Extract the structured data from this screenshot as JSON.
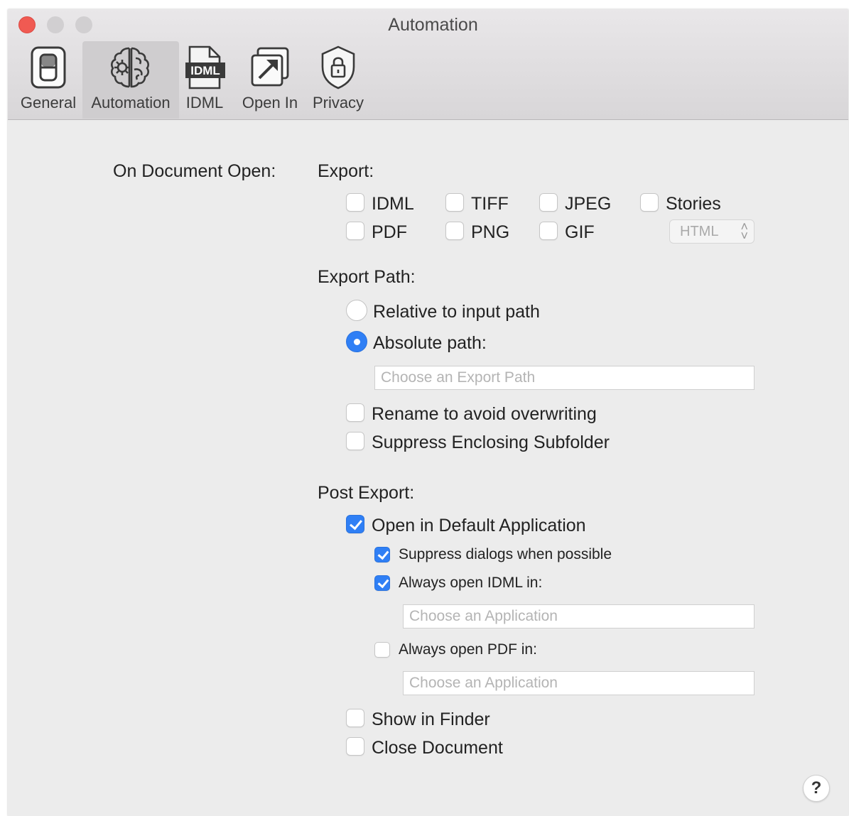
{
  "window": {
    "title": "Automation"
  },
  "toolbar": {
    "tabs": [
      {
        "label": "General",
        "icon": "toggle-switch-icon",
        "selected": false
      },
      {
        "label": "Automation",
        "icon": "brain-gear-icon",
        "selected": true
      },
      {
        "label": "IDML",
        "icon": "idml-file-icon",
        "selected": false
      },
      {
        "label": "Open In",
        "icon": "open-arrow-icon",
        "selected": false
      },
      {
        "label": "Privacy",
        "icon": "shield-lock-icon",
        "selected": false
      }
    ]
  },
  "main": {
    "on_open_label": "On Document Open:",
    "export": {
      "label": "Export:",
      "formats": [
        {
          "label": "IDML",
          "checked": false
        },
        {
          "label": "TIFF",
          "checked": false
        },
        {
          "label": "JPEG",
          "checked": false
        },
        {
          "label": "Stories",
          "checked": false
        },
        {
          "label": "PDF",
          "checked": false
        },
        {
          "label": "PNG",
          "checked": false
        },
        {
          "label": "GIF",
          "checked": false
        }
      ],
      "stories_format": {
        "value": "HTML"
      }
    },
    "export_path": {
      "label": "Export Path:",
      "relative_label": "Relative to input path",
      "absolute_label": "Absolute path:",
      "selected": "absolute",
      "path_placeholder": "Choose an Export Path",
      "rename_label": "Rename to avoid overwriting",
      "suppress_subfolder_label": "Suppress Enclosing Subfolder"
    },
    "post_export": {
      "label": "Post Export:",
      "open_default_label": "Open in Default Application",
      "suppress_dialogs_label": "Suppress dialogs when possible",
      "always_idml_label": "Always open IDML in:",
      "idml_app_placeholder": "Choose an Application",
      "always_pdf_label": "Always open PDF in:",
      "pdf_app_placeholder": "Choose an Application",
      "show_finder_label": "Show in Finder",
      "close_doc_label": "Close Document"
    },
    "help": "?"
  },
  "colors": {
    "accent": "#2f7ff5",
    "close": "#f05a52"
  }
}
